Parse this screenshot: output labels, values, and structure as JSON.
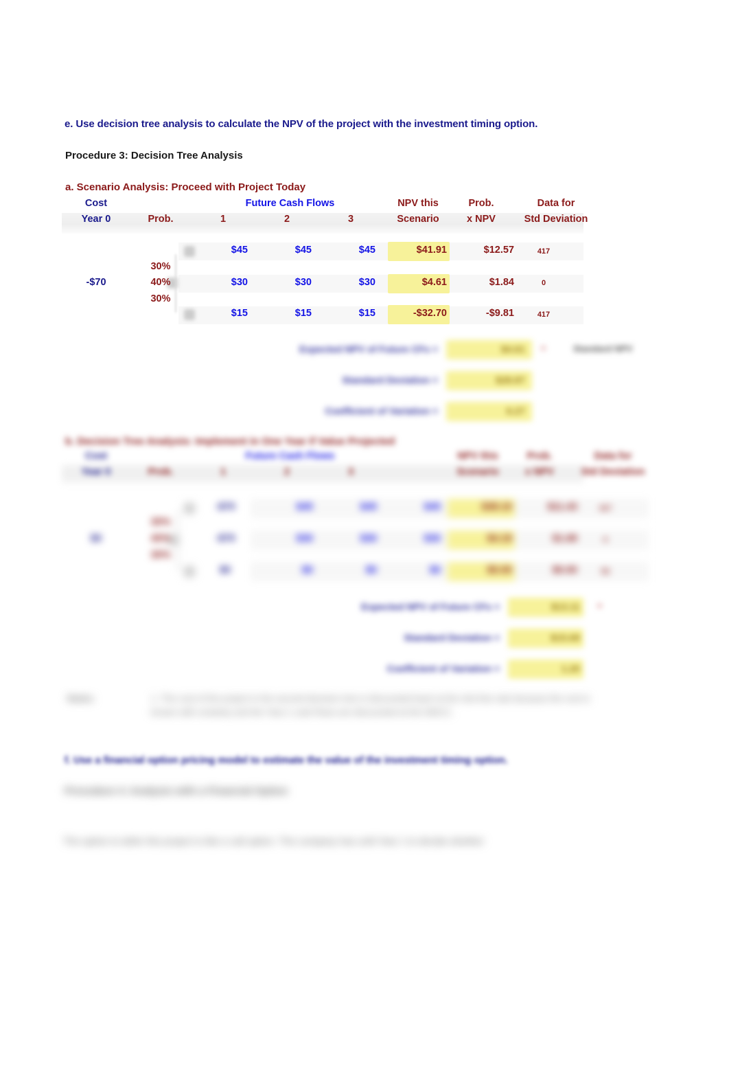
{
  "document": {
    "question_e": "e.  Use decision tree analysis to calculate the NPV of the project with the investment timing option.",
    "procedure_3_title": "Procedure 3: Decision Tree Analysis",
    "section_a_title": "a. Scenario Analysis: Proceed with Project Today",
    "section_b_title": "b. Decision Tree Analysis: Implement in One Year if Value Projected",
    "question_f": "f.  Use a financial option pricing model to estimate the value of the investment timing option.",
    "procedure_4_title": "Procedure 4: Analysis with a Financial Option",
    "closing_text": "The option to defer this project is like a call option. The company has until Year 1 to decide whether"
  },
  "table_headers": {
    "cost_top": "Cost",
    "cost_bottom": "Year 0",
    "prob": "Prob.",
    "future_cash_flows": "Future Cash Flows",
    "year1": "1",
    "year2": "2",
    "year3": "3",
    "npv_top": "NPV this",
    "npv_bottom": "Scenario",
    "probnpv_top": "Prob.",
    "probnpv_bottom": "x NPV",
    "stddev_top": "Data for",
    "stddev_bottom": "Std Deviation"
  },
  "scenario_table": {
    "cost_year0": "-$70",
    "rows": [
      {
        "prob": "30%",
        "cf1": "$45",
        "cf2": "$45",
        "cf3": "$45",
        "npv_scenario": "$41.91",
        "prob_x_npv": "$12.57",
        "std_dev_data": "417"
      },
      {
        "prob": "40%",
        "cf1": "$30",
        "cf2": "$30",
        "cf3": "$30",
        "npv_scenario": "$4.61",
        "prob_x_npv": "$1.84",
        "std_dev_data": "0"
      },
      {
        "prob": "30%",
        "cf1": "$15",
        "cf2": "$15",
        "cf3": "$15",
        "npv_scenario": "-$32.70",
        "prob_x_npv": "-$9.81",
        "std_dev_data": "417"
      }
    ],
    "summary": [
      {
        "label": "Expected NPV of Future CFs =",
        "value": "$4.61"
      },
      {
        "label": "Standard Deviation =",
        "value": "$28.87"
      },
      {
        "label": "Coefficient of Variation =",
        "value": "6.27"
      }
    ],
    "summary_side_note": "Standard NPV",
    "summary_side_mark": "="
  },
  "decision_tree_table": {
    "cost_year0": "$0",
    "rows": [
      {
        "prob": "30%",
        "year1_cost": "-$70",
        "cf1": "$45",
        "cf2": "$45",
        "cf3": "$45",
        "npv_scenario": "$38.10",
        "prob_x_npv": "$11.43",
        "std_dev_data": "417"
      },
      {
        "prob": "40%",
        "year1_cost": "-$70",
        "cf1": "$30",
        "cf2": "$30",
        "cf3": "$30",
        "npv_scenario": "$4.19",
        "prob_x_npv": "$1.68",
        "std_dev_data": "0"
      },
      {
        "prob": "30%",
        "year1_cost": "$0",
        "cf1": "$0",
        "cf2": "$0",
        "cf3": "$0",
        "npv_scenario": "$0.00",
        "prob_x_npv": "$0.00",
        "std_dev_data": "52"
      }
    ],
    "summary": [
      {
        "label": "Expected NPV of Future CFs =",
        "value": "$13.11"
      },
      {
        "label": "Standard Deviation =",
        "value": "$15.69"
      },
      {
        "label": "Coefficient of Variation =",
        "value": "1.20"
      }
    ],
    "summary_side_mark": "="
  },
  "notes": {
    "label": "Notes:",
    "body": "1. The cost of the project in the second decision tree is discounted back at the risk-free rate because the cost is known with certainty and the Year-1 cash flows are discounted at the WACC."
  },
  "colors": {
    "navy": "#1a1a8c",
    "dark_red": "#8b1a1a",
    "bright_blue": "#1414e6",
    "highlight_yellow": "#f7f29a",
    "row_shade": "#f1f1f1"
  }
}
